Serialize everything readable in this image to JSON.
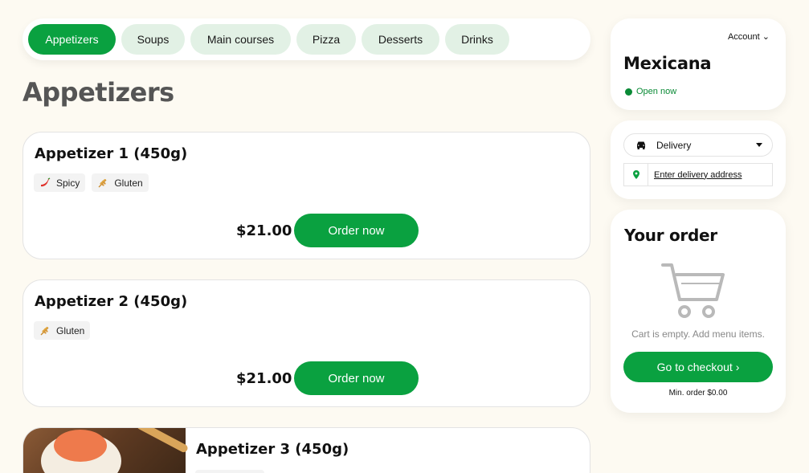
{
  "categories": [
    {
      "label": "Appetizers",
      "active": true
    },
    {
      "label": "Soups",
      "active": false
    },
    {
      "label": "Main courses",
      "active": false
    },
    {
      "label": "Pizza",
      "active": false
    },
    {
      "label": "Desserts",
      "active": false
    },
    {
      "label": "Drinks",
      "active": false
    }
  ],
  "section_title": "Appetizers",
  "items": [
    {
      "title": "Appetizer 1 (450g)",
      "tags": [
        {
          "icon": "chili-pepper-icon",
          "label": "Spicy"
        },
        {
          "icon": "wheat-icon",
          "label": "Gluten"
        }
      ],
      "price": "$21.00",
      "button": "Order now"
    },
    {
      "title": "Appetizer 2 (450g)",
      "tags": [
        {
          "icon": "wheat-icon",
          "label": "Gluten"
        }
      ],
      "price": "$21.00",
      "button": "Order now"
    },
    {
      "title": "Appetizer 3 (450g)"
    }
  ],
  "restaurant": {
    "account_label": "Account ⌄",
    "name": "Mexicana",
    "status": "Open now"
  },
  "delivery": {
    "mode": "Delivery",
    "address_link": "Enter delivery address"
  },
  "order": {
    "title": "Your order",
    "empty_text": "Cart is empty. Add menu items.",
    "checkout_label": "Go to checkout ›",
    "min_order": "Min. order $0.00"
  },
  "colors": {
    "accent": "#0aa140",
    "chip_bg": "#e2f1e5",
    "page_bg": "#fdfaf2",
    "status_green": "#0a8a36"
  }
}
